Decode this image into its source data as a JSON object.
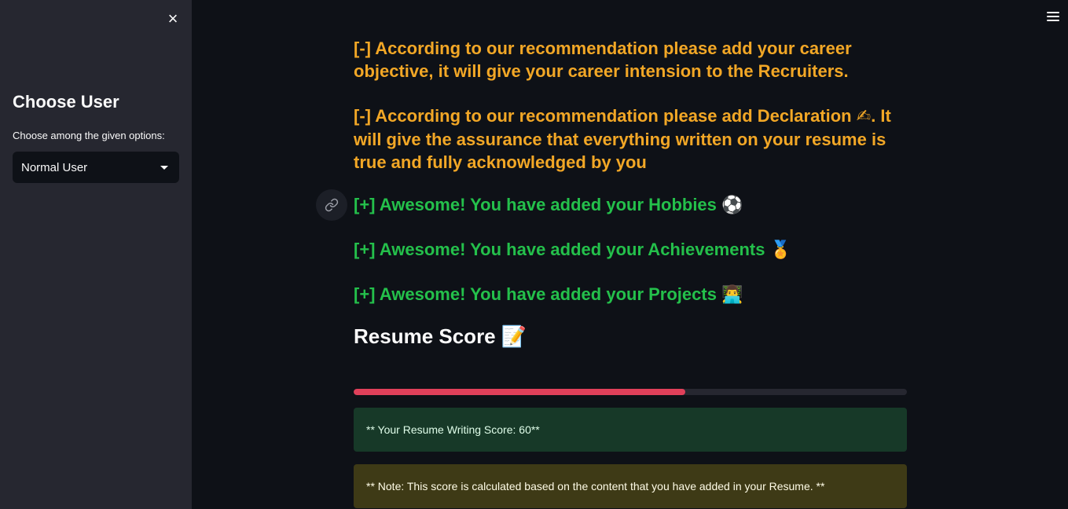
{
  "sidebar": {
    "title": "Choose User",
    "select_label": "Choose among the given options:",
    "selected_option": "Normal User",
    "close_icon": "×"
  },
  "messages": [
    {
      "text": "[-] According to our recommendation please add your career objective, it will give your career intension to the Recruiters.",
      "emoji": "",
      "type": "warn"
    },
    {
      "text": "[-] According to our recommendation please add Declaration",
      "emoji": "✍",
      "suffix": ". It will give the assurance that everything written on your resume is true and fully acknowledged by you",
      "type": "warn"
    },
    {
      "text": "[+] Awesome! You have added your Hobbies",
      "emoji": "⚽",
      "type": "ok"
    },
    {
      "text": "[+] Awesome! You have added your Achievements",
      "emoji": "🏅",
      "type": "ok"
    },
    {
      "text": "[+] Awesome! You have added your Projects",
      "emoji": "👨‍💻",
      "type": "ok"
    }
  ],
  "score": {
    "heading": "Resume Score",
    "heading_emoji": "📝",
    "progress_percent": 60,
    "result_text": "** Your Resume Writing Score: 60**",
    "note_text": "** Note: This score is calculated based on the content that you have added in your Resume. **"
  },
  "colors": {
    "warning_text": "#f2a726",
    "success_text": "#24c04b",
    "progress": "#e0405a"
  },
  "icons": {
    "close": "close-icon",
    "menu": "hamburger-menu-icon",
    "anchor": "link-icon",
    "dropdown": "chevron-down-icon"
  }
}
